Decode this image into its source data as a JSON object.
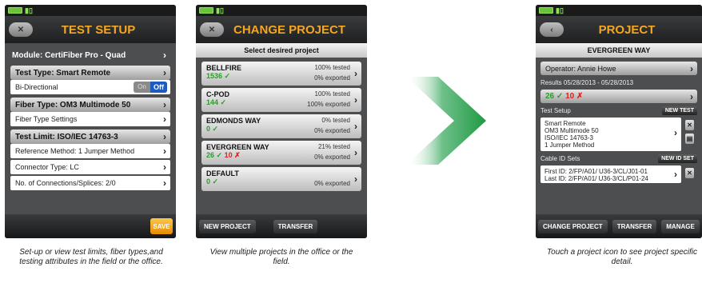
{
  "screen1": {
    "title": "TEST SETUP",
    "rows": [
      {
        "type": "plain",
        "label": "Module: CertiFiber Pro - Quad"
      },
      {
        "type": "hdr",
        "label": "Test Type: Smart Remote"
      },
      {
        "type": "toggle",
        "label": "Bi-Directional",
        "on": "On",
        "off": "Off"
      },
      {
        "type": "hdr",
        "label": "Fiber Type: OM3 Multimode 50"
      },
      {
        "type": "row",
        "label": "Fiber Type Settings"
      },
      {
        "type": "hdr",
        "label": "Test Limit: ISO/IEC 14763-3"
      },
      {
        "type": "row",
        "label": "Reference Method: 1 Jumper Method"
      },
      {
        "type": "row",
        "label": "Connector Type: LC"
      },
      {
        "type": "row",
        "label": "No. of Connections/Splices: 2/0"
      }
    ],
    "save": "SAVE",
    "caption": "Set-up or view test limits, fiber types,and testing attributes in the field or the office."
  },
  "screen2": {
    "title": "CHANGE PROJECT",
    "subtitle": "Select desired project",
    "projects": [
      {
        "name": "BELLFIRE",
        "count": "1536 ✓",
        "fail": "",
        "tested": "100% tested",
        "exported": "0% exported"
      },
      {
        "name": "C-POD",
        "count": "144 ✓",
        "fail": "",
        "tested": "100% tested",
        "exported": "100% exported"
      },
      {
        "name": "EDMONDS WAY",
        "count": "0 ✓",
        "fail": "",
        "tested": "0% tested",
        "exported": "0% exported"
      },
      {
        "name": "EVERGREEN WAY",
        "count": "26 ✓",
        "fail": "10 ✗",
        "tested": "21% tested",
        "exported": "0% exported"
      },
      {
        "name": "DEFAULT",
        "count": "0 ✓",
        "fail": "",
        "tested": "",
        "exported": "0% exported"
      }
    ],
    "new_project": "NEW PROJECT",
    "transfer": "TRANSFER",
    "caption": "View multiple projects in the office or the field."
  },
  "screen3": {
    "title": "PROJECT",
    "subtitle": "EVERGREEN WAY",
    "operator": "Operator: Annie Howe",
    "results_label": "Results 05/28/2013 - 05/28/2013",
    "pass": "26 ✓",
    "fail": "10 ✗",
    "test_setup_label": "Test Setup",
    "new_test": "NEW TEST",
    "setup_lines": [
      "Smart Remote",
      "OM3 Multimode 50",
      "ISO/IEC 14763-3",
      "1 Jumper Method"
    ],
    "cable_label": "Cable ID Sets",
    "new_id_set": "NEW ID SET",
    "cable_lines": [
      "First ID: 2/FP/A01/ U36-3/CL/J01-01",
      "Last ID: 2/FP/A01/ U36-3/CL/P01-24"
    ],
    "change_project": "CHANGE PROJECT",
    "transfer": "TRANSFER",
    "manage": "MANAGE",
    "caption": "Touch a project icon to see project specific detail."
  },
  "colors": {
    "accent": "#f5a623",
    "arrow": "#3aa655",
    "pass": "#2a9d2a",
    "fail": "#d22222",
    "toggle_off": "#1f5bbd"
  }
}
